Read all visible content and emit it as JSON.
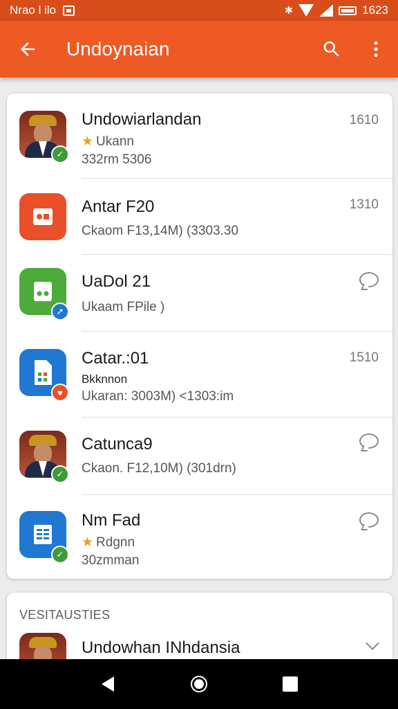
{
  "status_bar": {
    "left_text": "Nrao l ilo",
    "time": "1623",
    "bg_color": "#d84d1a"
  },
  "app_bar": {
    "title": "Undoynaian",
    "bg_color": "#ee5a24",
    "back_icon": "arrow-back-icon",
    "search_icon": "search-icon",
    "menu_icon": "more-vert-icon"
  },
  "list": {
    "items": [
      {
        "title": "Undowiarlandan",
        "rating": "Ukann",
        "sub": "332rm 5306",
        "meta": "1610",
        "icon": "photo-avatar",
        "badge": "check-badge"
      },
      {
        "title": "Antar F20",
        "sub": "Ckaom F13,14M) (3303.30",
        "meta": "1310",
        "icon": "slides-icon"
      },
      {
        "title": "UaDol 21",
        "sub": "Ukaam FPile )",
        "meta_icon": "chat-bubble-icon",
        "icon": "sheet-icon",
        "badge": "send-badge"
      },
      {
        "title": "Catar.:01",
        "line2": "Bkknnon",
        "sub": "Ukaran: 3003M) <1303:im",
        "meta": "1510",
        "icon": "doc-icon",
        "badge": "alert-badge"
      },
      {
        "title": "Catunca9",
        "sub": "Ckaon. F12,10M) (301drn)",
        "meta_icon": "chat-bubble-icon",
        "icon": "photo-avatar",
        "badge": "check-badge"
      },
      {
        "title": "Nm Fad",
        "rating": "Rdgnn",
        "sub": "30zmman",
        "meta_icon": "chat-bubble-icon",
        "icon": "docs-icon",
        "badge": "check-badge"
      }
    ]
  },
  "section2": {
    "label": "VESITAUSTIES",
    "item": {
      "title": "Undowhan INhdansia",
      "icon": "photo-avatar"
    }
  },
  "nav_bar": {
    "back_icon": "nav-back-icon",
    "home_icon": "nav-home-icon",
    "recents_icon": "nav-recents-icon"
  }
}
